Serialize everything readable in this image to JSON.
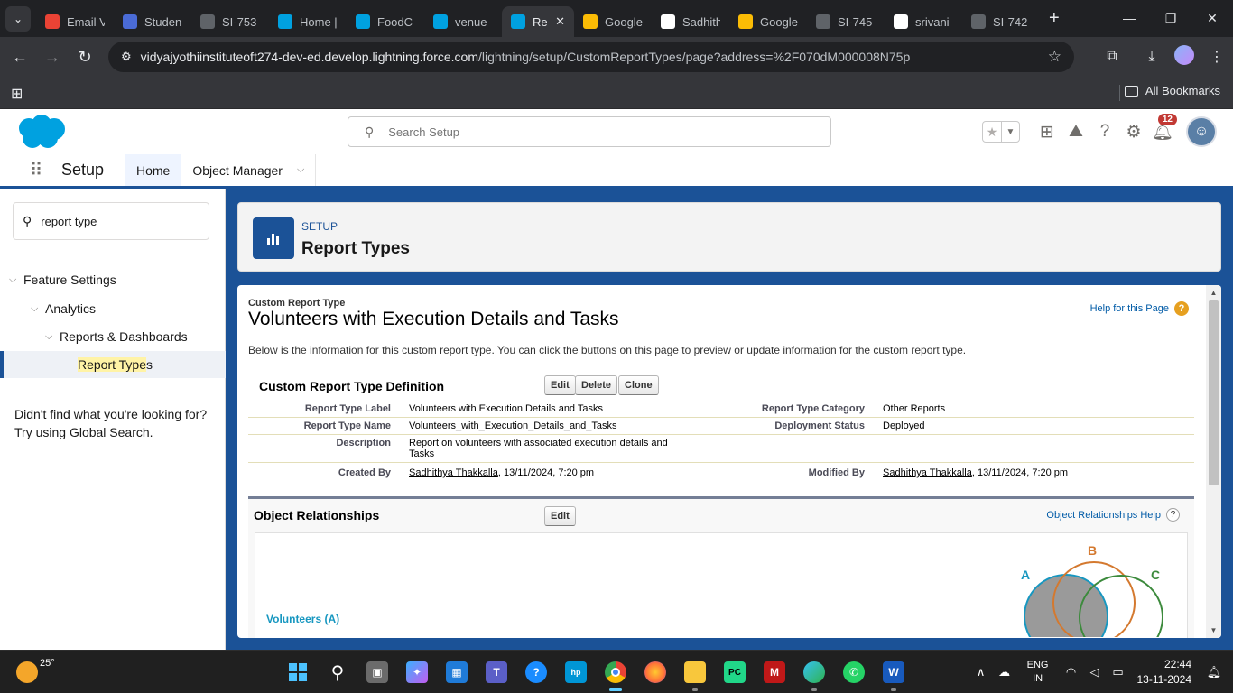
{
  "browser": {
    "tabs": [
      {
        "label": "Email V",
        "icon": "gmail-icon",
        "color": "#ea4335"
      },
      {
        "label": "Studen",
        "icon": "student-icon",
        "color": "#4a6bd6"
      },
      {
        "label": "SI-753",
        "icon": "doc-icon",
        "color": "#5f6368"
      },
      {
        "label": "Home |",
        "icon": "salesforce-icon",
        "color": "#00a1e0"
      },
      {
        "label": "FoodC",
        "icon": "salesforce-icon",
        "color": "#00a1e0"
      },
      {
        "label": "venue",
        "icon": "salesforce-icon",
        "color": "#00a1e0"
      },
      {
        "label": "Re",
        "icon": "salesforce-icon",
        "color": "#00a1e0",
        "active": true
      },
      {
        "label": "Google",
        "icon": "google-icon",
        "color": "#fbbc05"
      },
      {
        "label": "Sadhith",
        "icon": "github-icon",
        "color": "#ffffff"
      },
      {
        "label": "Google",
        "icon": "google-icon",
        "color": "#fbbc05"
      },
      {
        "label": "SI-745",
        "icon": "doc-icon",
        "color": "#5f6368"
      },
      {
        "label": "srivani",
        "icon": "github-icon",
        "color": "#ffffff"
      },
      {
        "label": "SI-742",
        "icon": "doc-icon",
        "color": "#5f6368"
      }
    ],
    "url_domain": "vidyajyothiinstituteoft274-dev-ed.develop.lightning.force.com",
    "url_path": "/lightning/setup/CustomReportTypes/page?address=%2F070dM000008N75p",
    "all_bookmarks": "All Bookmarks"
  },
  "sf_header": {
    "search_placeholder": "Search Setup",
    "notification_count": "12"
  },
  "setup_nav": {
    "app_title": "Setup",
    "tabs": [
      {
        "label": "Home",
        "active": true
      },
      {
        "label": "Object Manager"
      }
    ]
  },
  "sidebar": {
    "quick_find_value": "report type",
    "tree": [
      {
        "label": "Feature Settings"
      },
      {
        "label": "Analytics"
      },
      {
        "label": "Reports & Dashboards"
      },
      {
        "label_pre": "Report Type",
        "label_post": "s"
      }
    ],
    "not_found_line1": "Didn't find what you're looking for?",
    "not_found_line2": "Try using Global Search."
  },
  "page_header": {
    "eyebrow": "SETUP",
    "title": "Report Types"
  },
  "detail": {
    "type_label": "Custom Report Type",
    "title": "Volunteers with Execution Details and Tasks",
    "help_link": "Help for this Page",
    "description": "Below is the information for this custom report type. You can click the buttons on this page to preview or update information for the custom report type.",
    "definition_heading": "Custom Report Type Definition",
    "buttons": {
      "edit": "Edit",
      "delete": "Delete",
      "clone": "Clone"
    },
    "fields": {
      "report_type_label_lbl": "Report Type Label",
      "report_type_label_val": "Volunteers with Execution Details and Tasks",
      "report_type_category_lbl": "Report Type Category",
      "report_type_category_val": "Other Reports",
      "report_type_name_lbl": "Report Type Name",
      "report_type_name_val": "Volunteers_with_Execution_Details_and_Tasks",
      "deployment_status_lbl": "Deployment Status",
      "deployment_status_val": "Deployed",
      "description_lbl": "Description",
      "description_val": "Report on volunteers with associated execution details and Tasks",
      "created_by_lbl": "Created By",
      "created_by_user": "Sadhithya Thakkalla",
      "created_by_date": ", 13/11/2024, 7:20 pm",
      "modified_by_lbl": "Modified By",
      "modified_by_user": "Sadhithya Thakkalla",
      "modified_by_date": ", 13/11/2024, 7:20 pm"
    },
    "relationships": {
      "heading": "Object Relationships",
      "edit": "Edit",
      "help": "Object Relationships Help",
      "primary_object": "Volunteers (A)",
      "venn_labels": {
        "a": "A",
        "b": "B",
        "c": "C"
      },
      "venn_colors": {
        "a": "#1797c0",
        "b": "#d4792f",
        "c": "#3c8a3c"
      }
    }
  },
  "taskbar": {
    "temperature": "25°",
    "lang_line1": "ENG",
    "lang_line2": "IN",
    "time": "22:44",
    "date": "13-11-2024"
  }
}
